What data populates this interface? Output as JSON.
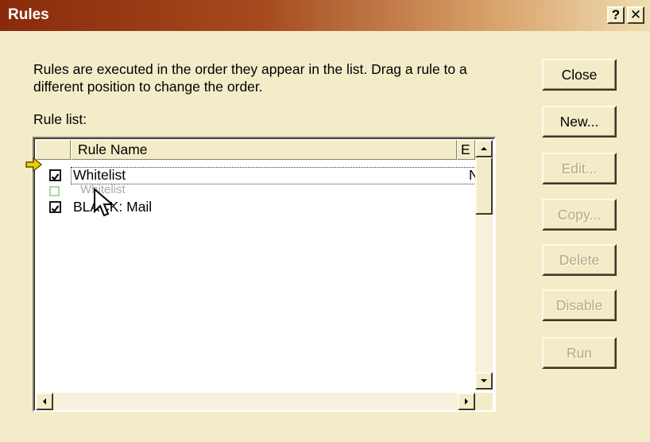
{
  "window": {
    "title": "Rules",
    "help_label": "?",
    "close_label": "✕"
  },
  "description": "Rules are executed in the order they appear in the list.  Drag a rule to a different position to change the order.",
  "rule_list": {
    "label": "Rule list:",
    "columns": [
      "Rule Name",
      "E"
    ],
    "rows": [
      {
        "name": "Whitelist",
        "second_col": "N",
        "checked": true,
        "focused": true
      },
      {
        "name": "BLACK: Mail",
        "second_col": "",
        "checked": true,
        "focused": false
      }
    ],
    "drag_ghost_text": "Whitelist"
  },
  "buttons": {
    "close": "Close",
    "new": "New...",
    "edit": "Edit...",
    "copy": "Copy...",
    "delete": "Delete",
    "disable": "Disable",
    "run": "Run"
  },
  "colors": {
    "dialog_bg": "#f3ecc9",
    "titlebar_start": "#8a2a0c",
    "disabled_text": "#b2a98c"
  }
}
